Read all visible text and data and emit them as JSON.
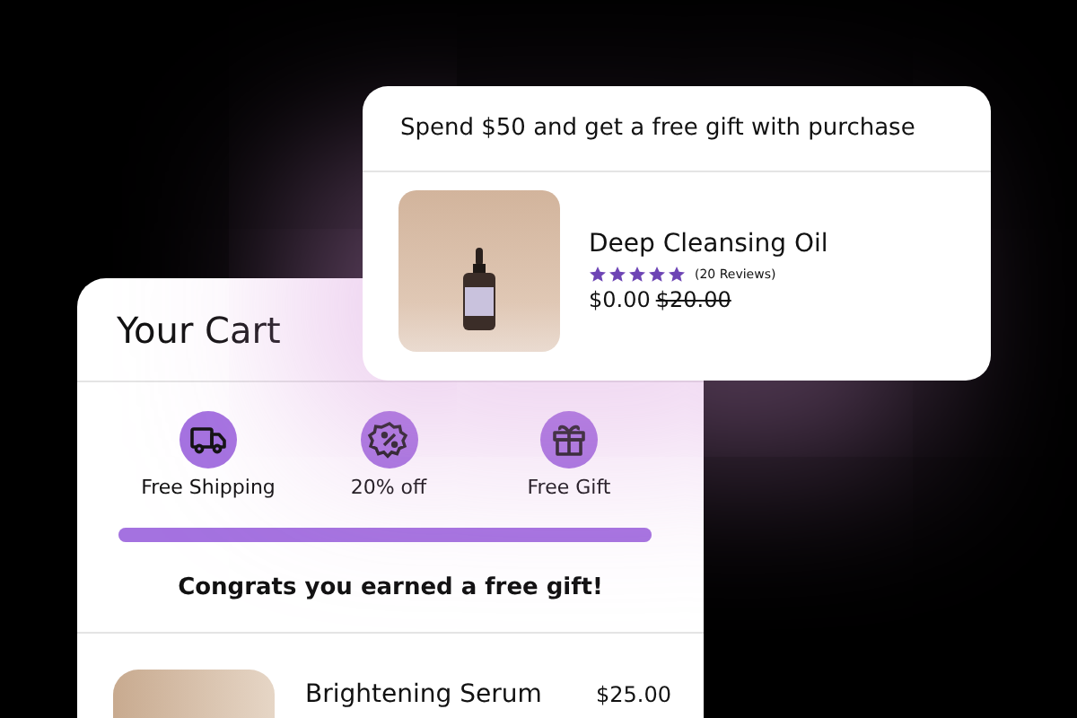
{
  "cart": {
    "title": "Your Cart",
    "perks": [
      {
        "kind": "truck",
        "label": "Free Shipping"
      },
      {
        "kind": "discount",
        "label": "20% off"
      },
      {
        "kind": "gift",
        "label": "Free Gift"
      }
    ],
    "progress": {
      "level": 1
    },
    "message": "Congrats you earned a free gift!",
    "items": [
      {
        "name": "Brightening Serum",
        "price": "$25.00"
      }
    ]
  },
  "offer": {
    "title": "Spend $50 and get a free gift with purchase",
    "product": {
      "name": "Deep Cleansing Oil",
      "stars": 5,
      "reviews": "(20 Reviews)",
      "price": "$0.00",
      "old_price": "$20.00"
    }
  }
}
